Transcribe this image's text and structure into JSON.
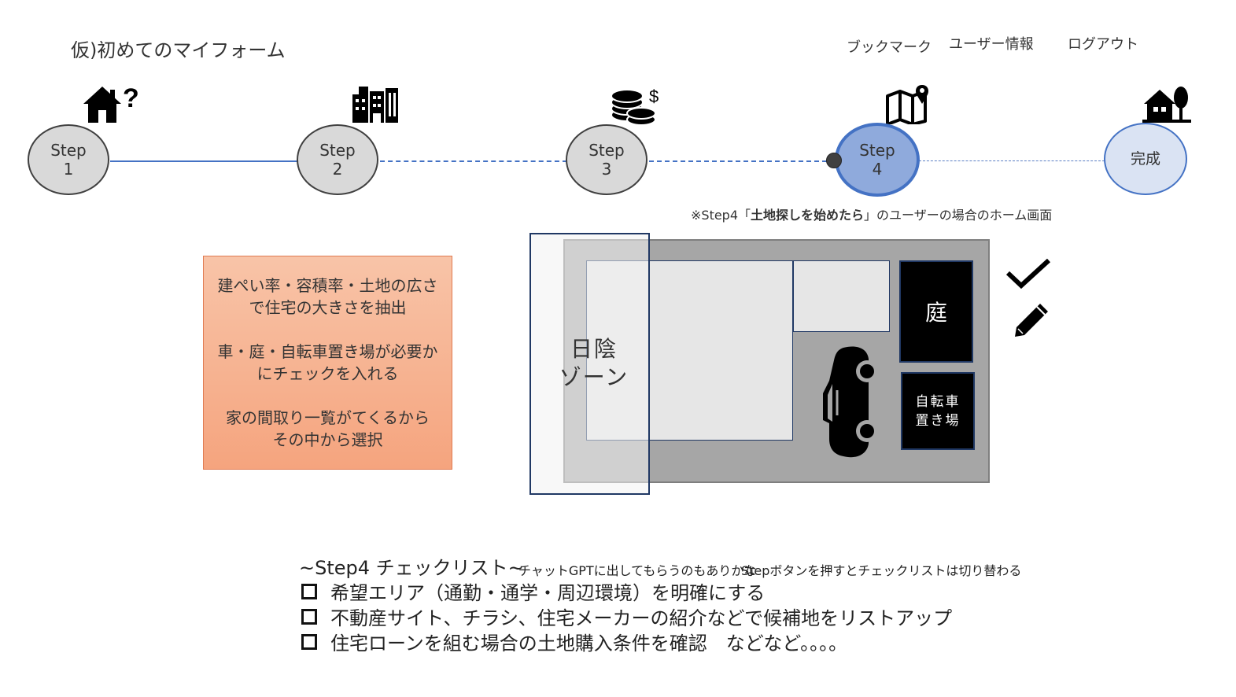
{
  "header": {
    "app_title": "仮)初めてのマイフォーム",
    "nav": {
      "bookmark": "ブックマーク",
      "user_info": "ユーザー情報",
      "logout": "ログアウト"
    }
  },
  "steps": {
    "step1": {
      "label": "Step",
      "number": "1",
      "icon": "house-question-icon"
    },
    "step2": {
      "label": "Step",
      "number": "2",
      "icon": "buildings-icon"
    },
    "step3": {
      "label": "Step",
      "number": "3",
      "icon": "coins-icon"
    },
    "step4": {
      "label": "Step",
      "number": "4",
      "icon": "map-pin-icon"
    },
    "complete": {
      "label": "完成",
      "icon": "home-tree-icon"
    },
    "current_step": 4,
    "active_color": "#4472c4"
  },
  "note": {
    "prefix": "※Step4「",
    "bold": "土地探しを始めたら",
    "suffix": "」のユーザーの場合のホーム画面"
  },
  "description": {
    "line1": "建ぺい率・容積率・土地の広さ",
    "line2": "で住宅の大きさを抽出",
    "line3": "車・庭・自転車置き場が必要か",
    "line4": "にチェックを入れる",
    "line5": "家の間取り一覧がてくるから",
    "line6": "その中から選択"
  },
  "plot_diagram": {
    "shade_zone_line1": "日陰",
    "shade_zone_line2": "ゾーン",
    "garden": "庭",
    "bike_line1": "自転車",
    "bike_line2": "置き場",
    "car_icon": "car-icon",
    "check_icon": "checkmark-icon",
    "edit_icon": "pencil-icon"
  },
  "checklist": {
    "title": "~Step4 チェックリスト~",
    "note1": "チャットGPTに出してもらうのもありかな",
    "note2": "Stepボタンを押すとチェックリストは切り替わる",
    "items": [
      "希望エリア（通勤・通学・周辺環境）を明確にする",
      "不動産サイト、チラシ、住宅メーカーの紹介などで候補地をリストアップ",
      "住宅ローンを組む場合の土地購入条件を確認　などなど。。。。"
    ]
  }
}
